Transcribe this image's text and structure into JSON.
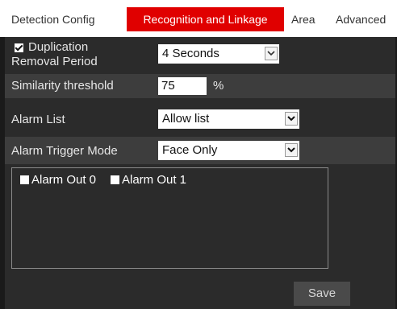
{
  "tabs": [
    {
      "label": "Detection Config"
    },
    {
      "label": "Recognition and Linkage"
    },
    {
      "label": "Area"
    },
    {
      "label": "Advanced"
    }
  ],
  "active_tab": "Recognition and Linkage",
  "colors": {
    "active_tab": "#e00000",
    "panel": "#2b2b2b",
    "band": "#3d3d3d"
  },
  "duplication": {
    "label_line1": "Duplication",
    "label_line2": "Removal Period",
    "checked": true,
    "value": "4 Seconds"
  },
  "similarity": {
    "label": "Similarity threshold",
    "value": "75",
    "unit": "%"
  },
  "alarm_list": {
    "label": "Alarm List",
    "value": "Allow list"
  },
  "alarm_trigger": {
    "label": "Alarm Trigger Mode",
    "value": "Face Only"
  },
  "alarm_outputs": [
    {
      "label": "Alarm Out 0",
      "checked": false
    },
    {
      "label": "Alarm Out 1",
      "checked": false
    }
  ],
  "save_label": "Save"
}
